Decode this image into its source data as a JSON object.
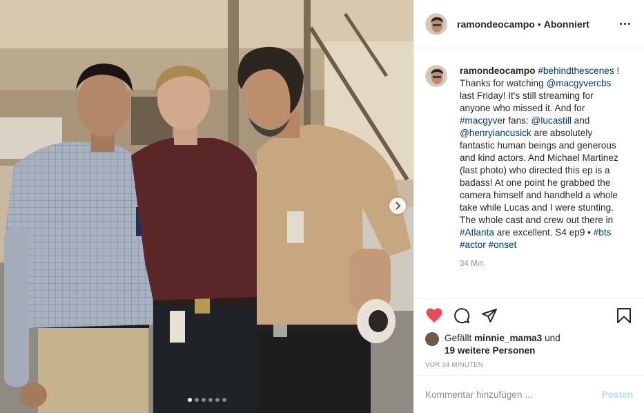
{
  "header": {
    "username": "ramondeocampo",
    "separator": "•",
    "follow_status": "Abonniert"
  },
  "caption": {
    "username": "ramondeocampo",
    "parts": [
      {
        "text": "#behindthescenes",
        "link": true
      },
      {
        "text": " ! Thanks for watching ",
        "link": false
      },
      {
        "text": "@macgyvercbs",
        "link": true
      },
      {
        "text": " last Friday! It's still streaming for anyone who missed it. And for ",
        "link": false
      },
      {
        "text": "#macgyver",
        "link": true
      },
      {
        "text": " fans: ",
        "link": false
      },
      {
        "text": "@lucastill",
        "link": true
      },
      {
        "text": " and ",
        "link": false
      },
      {
        "text": "@henryiancusick",
        "link": true
      },
      {
        "text": " are absolutely fantastic human beings and generous and kind actors. And Michael Martinez (last photo) who directed this ep is a badass! At one point he grabbed the camera himself and handheld a whole take while Lucas and I were stunting. The whole cast and crew out there in ",
        "link": false
      },
      {
        "text": "#Atlanta",
        "link": true
      },
      {
        "text": " are excellent. S4 ep9 • ",
        "link": false
      },
      {
        "text": "#bts",
        "link": true
      },
      {
        "text": " ",
        "link": false
      },
      {
        "text": "#actor",
        "link": true
      },
      {
        "text": " ",
        "link": false
      },
      {
        "text": "#onset",
        "link": true
      }
    ],
    "time": "34 Min."
  },
  "likes": {
    "prefix": "Gefällt",
    "user": "minnie_mama3",
    "middle": "und",
    "others": "19 weitere Personen"
  },
  "timestamp": "VOR 34 MINUTEN",
  "comment_input": {
    "placeholder": "Kommentar hinzufügen ...",
    "post_label": "Posten"
  },
  "carousel": {
    "total": 6,
    "active": 1
  },
  "icons": {
    "like": "heart-icon",
    "comment": "comment-icon",
    "share": "paper-plane-icon",
    "save": "bookmark-icon",
    "more": "more-options-icon",
    "next": "chevron-right-icon"
  },
  "colors": {
    "heart": "#ed4956",
    "link": "#00376b",
    "post_button_disabled": "#b2dffc",
    "muted": "#8e8e8e"
  }
}
